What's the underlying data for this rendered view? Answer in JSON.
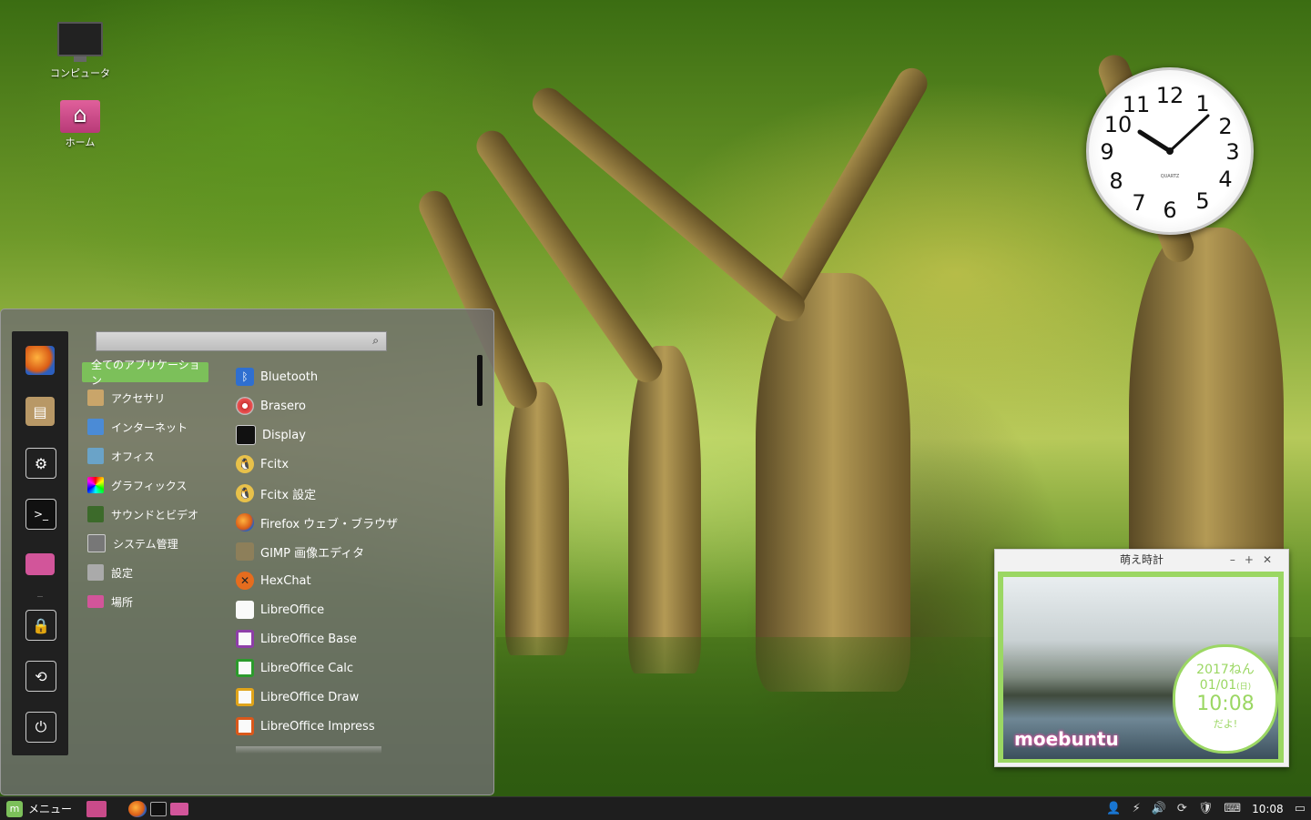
{
  "desktop": {
    "icons": [
      {
        "label": "コンピュータ",
        "icon": "computer-icon"
      },
      {
        "label": "ホーム",
        "icon": "home-folder-icon"
      }
    ]
  },
  "clock_widget": {
    "time": "10:08",
    "brand": "QUARTZ"
  },
  "menu": {
    "search": {
      "placeholder": "",
      "icon": "search-icon"
    },
    "favorites": [
      "firefox-icon",
      "package-manager-icon",
      "system-settings-icon",
      "terminal-icon",
      "files-icon",
      "lock-screen-icon",
      "logout-icon",
      "shutdown-icon"
    ],
    "categories": [
      {
        "label": "全てのアプリケーション",
        "selected": true
      },
      {
        "label": "アクセサリ",
        "icon": "accessories-icon"
      },
      {
        "label": "インターネット",
        "icon": "internet-icon"
      },
      {
        "label": "オフィス",
        "icon": "office-icon"
      },
      {
        "label": "グラフィックス",
        "icon": "graphics-icon"
      },
      {
        "label": "サウンドとビデオ",
        "icon": "sound-video-icon"
      },
      {
        "label": "システム管理",
        "icon": "administration-icon"
      },
      {
        "label": "設定",
        "icon": "preferences-icon"
      },
      {
        "label": "場所",
        "icon": "places-icon"
      }
    ],
    "apps": [
      {
        "label": "Bluetooth",
        "icon": "bluetooth-icon"
      },
      {
        "label": "Brasero",
        "icon": "brasero-icon"
      },
      {
        "label": "Display",
        "icon": "display-icon"
      },
      {
        "label": "Fcitx",
        "icon": "fcitx-icon"
      },
      {
        "label": "Fcitx 設定",
        "icon": "fcitx-settings-icon"
      },
      {
        "label": "Firefox ウェブ・ブラウザ",
        "icon": "firefox-icon"
      },
      {
        "label": "GIMP 画像エディタ",
        "icon": "gimp-icon"
      },
      {
        "label": "HexChat",
        "icon": "hexchat-icon"
      },
      {
        "label": "LibreOffice",
        "icon": "libreoffice-icon"
      },
      {
        "label": "LibreOffice Base",
        "icon": "libreoffice-base-icon"
      },
      {
        "label": "LibreOffice Calc",
        "icon": "libreoffice-calc-icon"
      },
      {
        "label": "LibreOffice Draw",
        "icon": "libreoffice-draw-icon"
      },
      {
        "label": "LibreOffice Impress",
        "icon": "libreoffice-impress-icon"
      }
    ]
  },
  "moe_clock": {
    "title": "萌え時計",
    "brand": "moebuntu",
    "year": "2017ねん",
    "date": "01/01",
    "weekday": "(日)",
    "time": "10:08",
    "suffix": "だよ!"
  },
  "taskbar": {
    "menu_label": "メニュー",
    "clock": "10:08"
  }
}
